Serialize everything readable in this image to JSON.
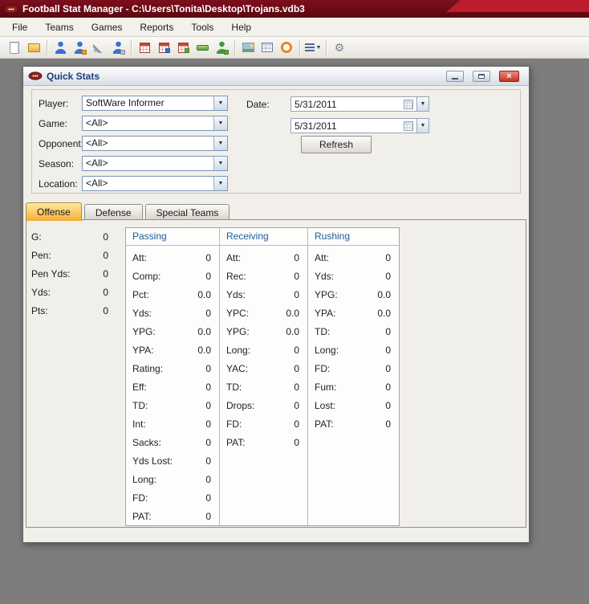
{
  "window": {
    "title": "Football Stat Manager - C:\\Users\\Tonita\\Desktop\\Trojans.vdb3"
  },
  "glyphs": {
    "close": "×",
    "caret": "▼",
    "gear": "⚙"
  },
  "menu": {
    "items": [
      "File",
      "Teams",
      "Games",
      "Reports",
      "Tools",
      "Help"
    ]
  },
  "toolbar": {
    "items": [
      {
        "name": "new-icon",
        "type": "page"
      },
      {
        "name": "open-icon",
        "type": "folder"
      },
      {
        "type": "sep"
      },
      {
        "name": "players-icon",
        "type": "person"
      },
      {
        "name": "edit-player-icon",
        "type": "person",
        "badge": "orange"
      },
      {
        "name": "tools-wrench-icon",
        "type": "wrench"
      },
      {
        "name": "print-player-icon",
        "type": "person",
        "badge": "gray"
      },
      {
        "type": "sep"
      },
      {
        "name": "schedule-grid-icon",
        "type": "grid"
      },
      {
        "name": "roster-grid-icon",
        "type": "grid",
        "badge": "blue"
      },
      {
        "name": "export-grid-icon",
        "type": "grid",
        "badge": "green"
      },
      {
        "name": "field-icon",
        "type": "greenbar"
      },
      {
        "name": "add-player-icon",
        "type": "person-green",
        "badge": "green"
      },
      {
        "type": "sep"
      },
      {
        "name": "photo-icon",
        "type": "photo"
      },
      {
        "name": "stats-table-icon",
        "type": "table"
      },
      {
        "name": "timer-icon",
        "type": "clock"
      },
      {
        "type": "sep"
      },
      {
        "name": "view-list-icon",
        "type": "list",
        "caret": true
      },
      {
        "type": "sep"
      },
      {
        "name": "settings-gear-icon",
        "type": "gear"
      }
    ]
  },
  "dialog": {
    "title": "Quick Stats",
    "filters": [
      {
        "label": "Player:",
        "value": "SoftWare Informer"
      },
      {
        "label": "Game:",
        "value": "<All>"
      },
      {
        "label": "Opponent:",
        "value": "<All>"
      },
      {
        "label": "Season:",
        "value": "<All>"
      },
      {
        "label": "Location:",
        "value": "<All>"
      }
    ],
    "date": {
      "label": "Date:",
      "from": "5/31/2011",
      "to": "5/31/2011"
    },
    "refresh_label": "Refresh",
    "tabs": [
      {
        "label": "Offense",
        "active": true
      },
      {
        "label": "Defense",
        "active": false
      },
      {
        "label": "Special Teams",
        "active": false
      }
    ],
    "general_stats": [
      {
        "label": "G:",
        "value": "0"
      },
      {
        "label": "Pen:",
        "value": "0"
      },
      {
        "label": "Pen Yds:",
        "value": "0"
      },
      {
        "label": "Yds:",
        "value": "0"
      },
      {
        "label": "Pts:",
        "value": "0"
      }
    ],
    "stat_columns": [
      {
        "header": "Passing",
        "rows": [
          [
            "Att:",
            "0"
          ],
          [
            "Comp:",
            "0"
          ],
          [
            "Pct:",
            "0.0"
          ],
          [
            "Yds:",
            "0"
          ],
          [
            "YPG:",
            "0.0"
          ],
          [
            "YPA:",
            "0.0"
          ],
          [
            "Rating:",
            "0"
          ],
          [
            "Eff:",
            "0"
          ],
          [
            "TD:",
            "0"
          ],
          [
            "Int:",
            "0"
          ],
          [
            "Sacks:",
            "0"
          ],
          [
            "Yds Lost:",
            "0"
          ],
          [
            "Long:",
            "0"
          ],
          [
            "FD:",
            "0"
          ],
          [
            "PAT:",
            "0"
          ]
        ]
      },
      {
        "header": "Receiving",
        "rows": [
          [
            "Att:",
            "0"
          ],
          [
            "Rec:",
            "0"
          ],
          [
            "Yds:",
            "0"
          ],
          [
            "YPC:",
            "0.0"
          ],
          [
            "YPG:",
            "0.0"
          ],
          [
            "Long:",
            "0"
          ],
          [
            "YAC:",
            "0"
          ],
          [
            "TD:",
            "0"
          ],
          [
            "Drops:",
            "0"
          ],
          [
            "FD:",
            "0"
          ],
          [
            "PAT:",
            "0"
          ]
        ]
      },
      {
        "header": "Rushing",
        "rows": [
          [
            "Att:",
            "0"
          ],
          [
            "Yds:",
            "0"
          ],
          [
            "YPG:",
            "0.0"
          ],
          [
            "YPA:",
            "0.0"
          ],
          [
            "TD:",
            "0"
          ],
          [
            "Long:",
            "0"
          ],
          [
            "FD:",
            "0"
          ],
          [
            "Fum:",
            "0"
          ],
          [
            "Lost:",
            "0"
          ],
          [
            "PAT:",
            "0"
          ]
        ]
      }
    ]
  },
  "colors": {
    "titlebar": "#6b0b17",
    "client_bg": "#7d7d7d",
    "tab_active": "#f6ae39",
    "table_header_text": "#1f5c99",
    "close_button": "#c23325"
  }
}
